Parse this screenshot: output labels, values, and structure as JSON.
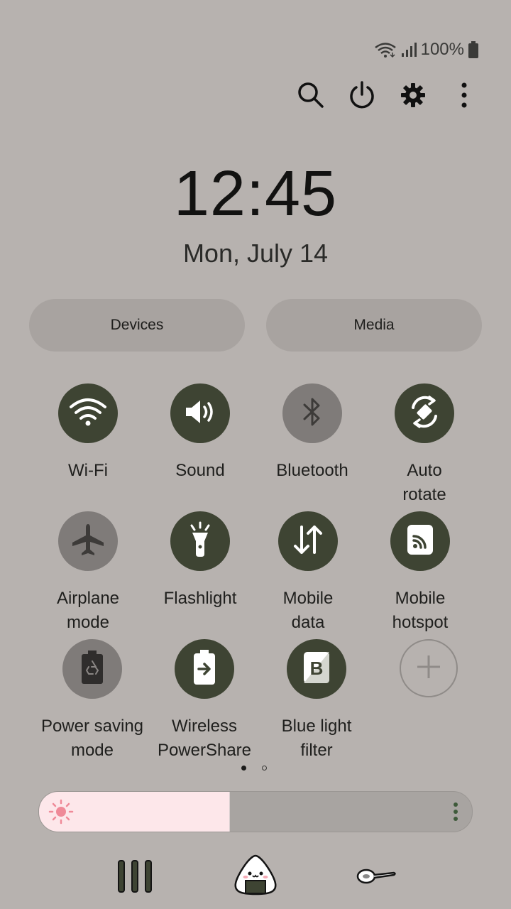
{
  "status_bar": {
    "battery_text": "100%",
    "icons": [
      "wifi-icon",
      "signal-icon",
      "battery-icon"
    ]
  },
  "top_actions": [
    "search-icon",
    "power-icon",
    "settings-gear-icon",
    "more-vertical-icon"
  ],
  "clock": {
    "time": "12:45",
    "date": "Mon, July 14"
  },
  "pills": {
    "devices": "Devices",
    "media": "Media"
  },
  "tiles": [
    {
      "label": "Wi-Fi",
      "state": "on",
      "icon": "wifi-icon"
    },
    {
      "label": "Sound",
      "state": "on",
      "icon": "sound-icon"
    },
    {
      "label": "Bluetooth",
      "state": "off",
      "icon": "bluetooth-icon"
    },
    {
      "label": "Auto\nrotate",
      "state": "on",
      "icon": "auto-rotate-icon"
    },
    {
      "label": "Airplane\nmode",
      "state": "off",
      "icon": "airplane-icon"
    },
    {
      "label": "Flashlight",
      "state": "on",
      "icon": "flashlight-icon"
    },
    {
      "label": "Mobile\ndata",
      "state": "on",
      "icon": "mobile-data-icon"
    },
    {
      "label": "Mobile\nhotspot",
      "state": "on",
      "icon": "hotspot-icon"
    },
    {
      "label": "Power saving\nmode",
      "state": "off",
      "icon": "power-saving-icon"
    },
    {
      "label": "Wireless\nPowerShare",
      "state": "on",
      "icon": "powershare-icon"
    },
    {
      "label": "Blue light\nfilter",
      "state": "on",
      "icon": "blue-light-filter-icon"
    },
    {
      "label": "",
      "state": "add",
      "icon": "add-icon"
    }
  ],
  "page_indicator": {
    "current": 1,
    "total": 2
  },
  "brightness": {
    "level": 0.44
  },
  "colors": {
    "background": "#b7b2af",
    "tile_on": "#3e4433",
    "tile_off": "#7f7b79",
    "brightness_fill": "#fde7ea",
    "sun": "#ef8a98"
  },
  "nav_bar": [
    "recents-icon",
    "home-onigiri-icon",
    "back-spoon-icon"
  ]
}
